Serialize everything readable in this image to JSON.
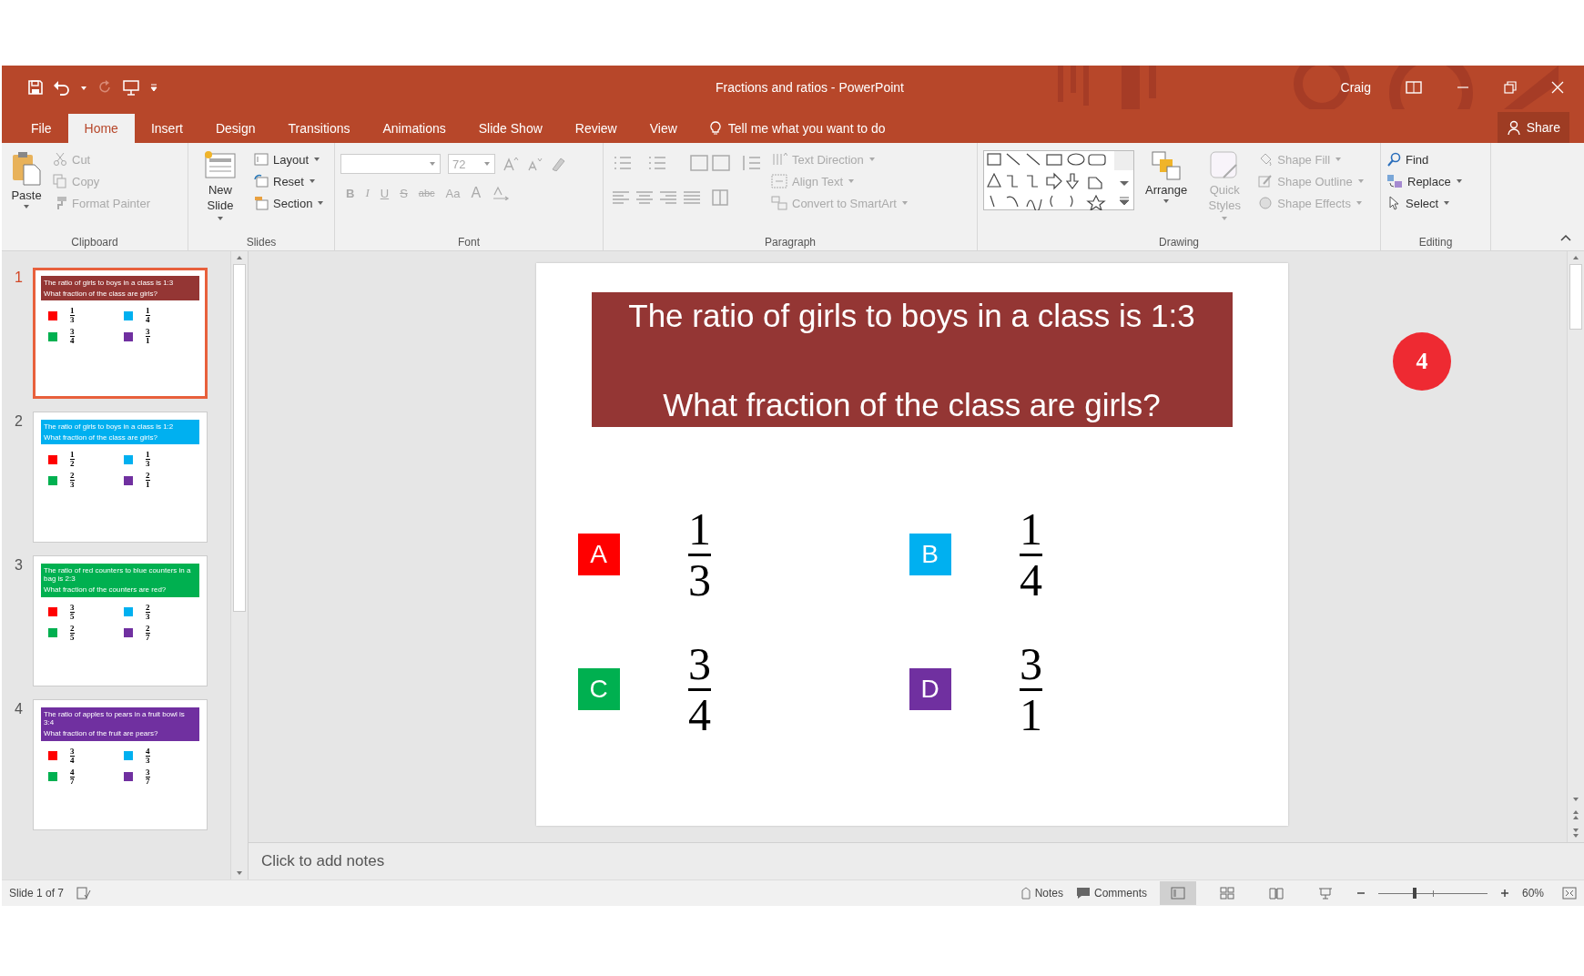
{
  "title_bar": {
    "title": "Fractions and ratios - PowerPoint",
    "user": "Craig"
  },
  "tabs": [
    {
      "label": "File",
      "selected": false
    },
    {
      "label": "Home",
      "selected": true
    },
    {
      "label": "Insert",
      "selected": false
    },
    {
      "label": "Design",
      "selected": false
    },
    {
      "label": "Transitions",
      "selected": false
    },
    {
      "label": "Animations",
      "selected": false
    },
    {
      "label": "Slide Show",
      "selected": false
    },
    {
      "label": "Review",
      "selected": false
    },
    {
      "label": "View",
      "selected": false
    }
  ],
  "tell_me": "Tell me what you want to do",
  "share": "Share",
  "ribbon": {
    "clipboard": {
      "label": "Clipboard",
      "paste": "Paste",
      "items": [
        {
          "label": "Cut",
          "disabled": true
        },
        {
          "label": "Copy",
          "disabled": true
        },
        {
          "label": "Format Painter",
          "disabled": true
        }
      ]
    },
    "slides": {
      "label": "Slides",
      "new_slide": "New Slide",
      "items": [
        {
          "label": "Layout",
          "disabled": false
        },
        {
          "label": "Reset",
          "disabled": false
        },
        {
          "label": "Section",
          "disabled": false
        }
      ]
    },
    "font": {
      "label": "Font",
      "size": "72",
      "format_buttons": [
        "B",
        "I",
        "U",
        "S",
        "abc",
        "Aa",
        "A"
      ]
    },
    "paragraph": {
      "label": "Paragraph",
      "items": [
        {
          "label": "Text Direction",
          "disabled": true
        },
        {
          "label": "Align Text",
          "disabled": true
        },
        {
          "label": "Convert to SmartArt",
          "disabled": true
        }
      ]
    },
    "drawing": {
      "label": "Drawing",
      "arrange": "Arrange",
      "quick_styles": "Quick Styles",
      "items": [
        {
          "label": "Shape Fill",
          "disabled": true
        },
        {
          "label": "Shape Outline",
          "disabled": true
        },
        {
          "label": "Shape Effects",
          "disabled": true
        }
      ]
    },
    "editing": {
      "label": "Editing",
      "items": [
        {
          "label": "Find",
          "disabled": false
        },
        {
          "label": "Replace",
          "disabled": false
        },
        {
          "label": "Select",
          "disabled": false
        }
      ]
    }
  },
  "thumbnails": [
    {
      "number": "1",
      "selected": true,
      "color": "#943634",
      "lines": [
        "The ratio of girls to boys in a class is 1:3",
        "What fraction of the class are girls?"
      ],
      "options": [
        {
          "color": "#ff0000",
          "numerator": "1",
          "denominator": "3"
        },
        {
          "color": "#00b0f0",
          "numerator": "1",
          "denominator": "4"
        },
        {
          "color": "#00b050",
          "numerator": "3",
          "denominator": "4"
        },
        {
          "color": "#7030a0",
          "numerator": "3",
          "denominator": "1"
        }
      ]
    },
    {
      "number": "2",
      "selected": false,
      "color": "#00b0f0",
      "lines": [
        "The ratio of girls to boys in a class is 1:2",
        "What fraction of the class are girls?"
      ],
      "options": [
        {
          "color": "#ff0000",
          "numerator": "1",
          "denominator": "2"
        },
        {
          "color": "#00b0f0",
          "numerator": "1",
          "denominator": "3"
        },
        {
          "color": "#00b050",
          "numerator": "2",
          "denominator": "3"
        },
        {
          "color": "#7030a0",
          "numerator": "2",
          "denominator": "1"
        }
      ]
    },
    {
      "number": "3",
      "selected": false,
      "color": "#00b050",
      "lines": [
        "The ratio of red counters to blue counters in a bag is 2:3",
        "What fraction of the counters are red?"
      ],
      "options": [
        {
          "color": "#ff0000",
          "numerator": "3",
          "denominator": "5"
        },
        {
          "color": "#00b0f0",
          "numerator": "2",
          "denominator": "3"
        },
        {
          "color": "#00b050",
          "numerator": "2",
          "denominator": "5"
        },
        {
          "color": "#7030a0",
          "numerator": "2",
          "denominator": "7"
        }
      ]
    },
    {
      "number": "4",
      "selected": false,
      "color": "#7030a0",
      "lines": [
        "The ratio of apples to pears in a fruit bowl is 3:4",
        "What fraction of the fruit are pears?"
      ],
      "options": [
        {
          "color": "#ff0000",
          "numerator": "3",
          "denominator": "4"
        },
        {
          "color": "#00b0f0",
          "numerator": "4",
          "denominator": "3"
        },
        {
          "color": "#00b050",
          "numerator": "4",
          "denominator": "7"
        },
        {
          "color": "#7030a0",
          "numerator": "3",
          "denominator": "7"
        }
      ]
    }
  ],
  "slide": {
    "color": "#943634",
    "lines": [
      "The ratio of girls to boys in a class is 1:3",
      "What fraction of the class are girls?"
    ],
    "options": [
      {
        "letter": "A",
        "color": "#ff0000",
        "numerator": "1",
        "denominator": "3"
      },
      {
        "letter": "B",
        "color": "#00b0f0",
        "numerator": "1",
        "denominator": "4"
      },
      {
        "letter": "C",
        "color": "#00b050",
        "numerator": "3",
        "denominator": "4"
      },
      {
        "letter": "D",
        "color": "#7030a0",
        "numerator": "3",
        "denominator": "1"
      }
    ]
  },
  "step_badge": "4",
  "notes": {
    "placeholder": "Click to add notes"
  },
  "status_bar": {
    "slide_info": "Slide 1 of 7",
    "notes": "Notes",
    "comments": "Comments",
    "views": [
      {
        "kind": "normal",
        "selected": true
      },
      {
        "kind": "sorter",
        "selected": false
      },
      {
        "kind": "reading",
        "selected": false
      },
      {
        "kind": "slideshow",
        "selected": false
      }
    ],
    "zoom": {
      "level": 0.33
    },
    "zoom_text": "60%"
  }
}
